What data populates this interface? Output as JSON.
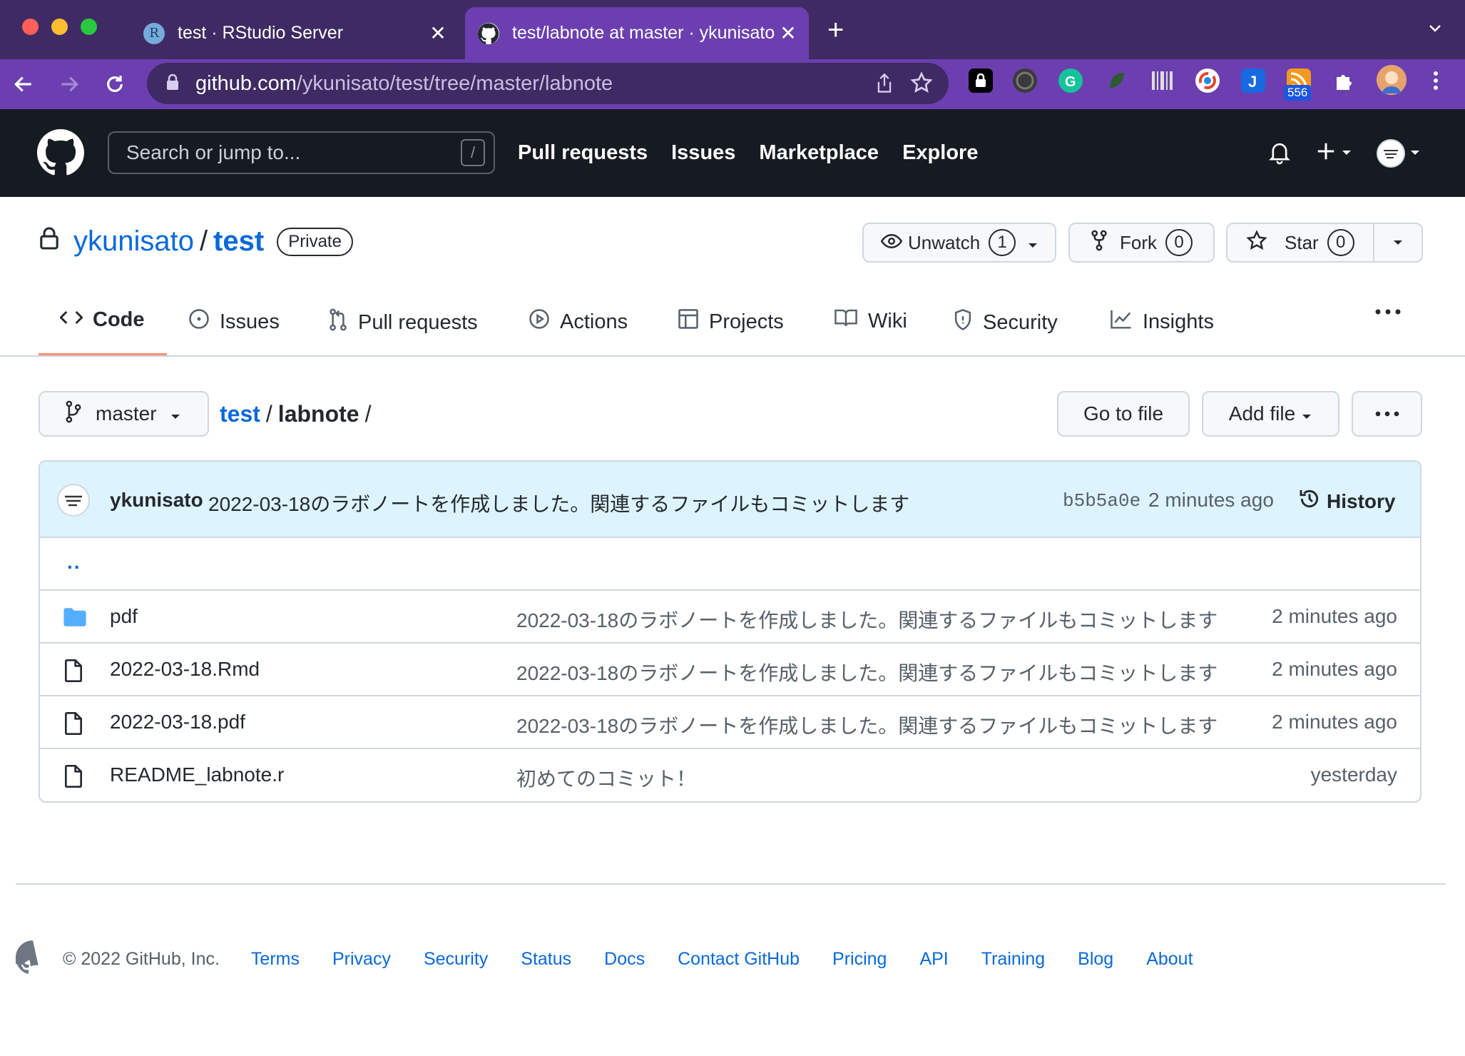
{
  "browser": {
    "tabs": [
      {
        "title": "test · RStudio Server",
        "favicon": "R",
        "active": false
      },
      {
        "title": "test/labnote at master · ykunisato",
        "active": true
      }
    ],
    "url_host": "github.com",
    "url_path": "/ykunisato/test/tree/master/labnote",
    "extension_badge": "556"
  },
  "gh_header": {
    "search_placeholder": "Search or jump to...",
    "search_shortcut": "/",
    "nav": [
      "Pull requests",
      "Issues",
      "Marketplace",
      "Explore"
    ]
  },
  "repo": {
    "owner": "ykunisato",
    "separator": "/",
    "name": "test",
    "visibility": "Private",
    "watch_label": "Unwatch",
    "watch_count": "1",
    "fork_label": "Fork",
    "fork_count": "0",
    "star_label": "Star",
    "star_count": "0"
  },
  "repo_tabs": [
    {
      "label": "Code",
      "icon": "code-icon",
      "selected": true
    },
    {
      "label": "Issues",
      "icon": "issue-icon"
    },
    {
      "label": "Pull requests",
      "icon": "pull-request-icon"
    },
    {
      "label": "Actions",
      "icon": "play-icon"
    },
    {
      "label": "Projects",
      "icon": "table-icon"
    },
    {
      "label": "Wiki",
      "icon": "book-icon"
    },
    {
      "label": "Security",
      "icon": "shield-icon"
    },
    {
      "label": "Insights",
      "icon": "graph-icon"
    }
  ],
  "file_nav": {
    "branch": "master",
    "breadcrumb_root": "test",
    "breadcrumb_sep": "/",
    "breadcrumb_current": "labnote",
    "breadcrumb_trailing": "/",
    "go_to_file": "Go to file",
    "add_file": "Add file"
  },
  "latest_commit": {
    "author": "ykunisato",
    "message": "2022-03-18のラボノートを作成しました。関連するファイルもコミットします",
    "sha": "b5b5a0e",
    "time": "2 minutes ago",
    "history_label": "History"
  },
  "parent_dir": "..",
  "files": [
    {
      "name": "pdf",
      "type": "folder",
      "message": "2022-03-18のラボノートを作成しました。関連するファイルもコミットします",
      "time": "2 minutes ago"
    },
    {
      "name": "2022-03-18.Rmd",
      "type": "file",
      "message": "2022-03-18のラボノートを作成しました。関連するファイルもコミットします",
      "time": "2 minutes ago"
    },
    {
      "name": "2022-03-18.pdf",
      "type": "file",
      "message": "2022-03-18のラボノートを作成しました。関連するファイルもコミットします",
      "time": "2 minutes ago"
    },
    {
      "name": "README_labnote.r",
      "type": "file",
      "message": "初めてのコミット！",
      "time": "yesterday"
    }
  ],
  "footer": {
    "copyright": "© 2022 GitHub, Inc.",
    "links": [
      "Terms",
      "Privacy",
      "Security",
      "Status",
      "Docs",
      "Contact GitHub",
      "Pricing",
      "API",
      "Training",
      "Blog",
      "About"
    ]
  },
  "colors": {
    "tab_bar": "#3f2a63",
    "toolbar": "#6b3fb0",
    "gh_header": "#161b22",
    "link": "#0969da",
    "commit_row": "#ddf4ff",
    "tab_underline": "#fd8c73"
  }
}
